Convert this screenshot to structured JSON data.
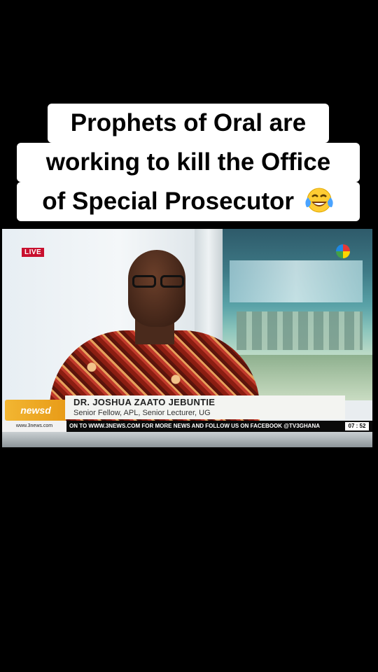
{
  "caption": {
    "lines": [
      "Prophets of Oral are",
      "working to kill the Office",
      "of Special Prosecutor"
    ],
    "emoji": "face-with-tears-of-joy-icon"
  },
  "broadcast": {
    "live_badge": "LIVE",
    "show_logo": "newsd",
    "lower_third": {
      "name": "DR. JOSHUA ZAATO JEBUNTIE",
      "title": "Senior Fellow, APL, Senior Lecturer, UG"
    },
    "ticker": {
      "site": "www.3news.com",
      "text": "ON TO WWW.3NEWS.COM FOR MORE NEWS AND FOLLOW US ON FACEBOOK @TV3GHANA",
      "time": "07 : 52"
    }
  },
  "colors": {
    "background": "#000000",
    "live": "#c8102e",
    "caption_bg": "#ffffff"
  }
}
